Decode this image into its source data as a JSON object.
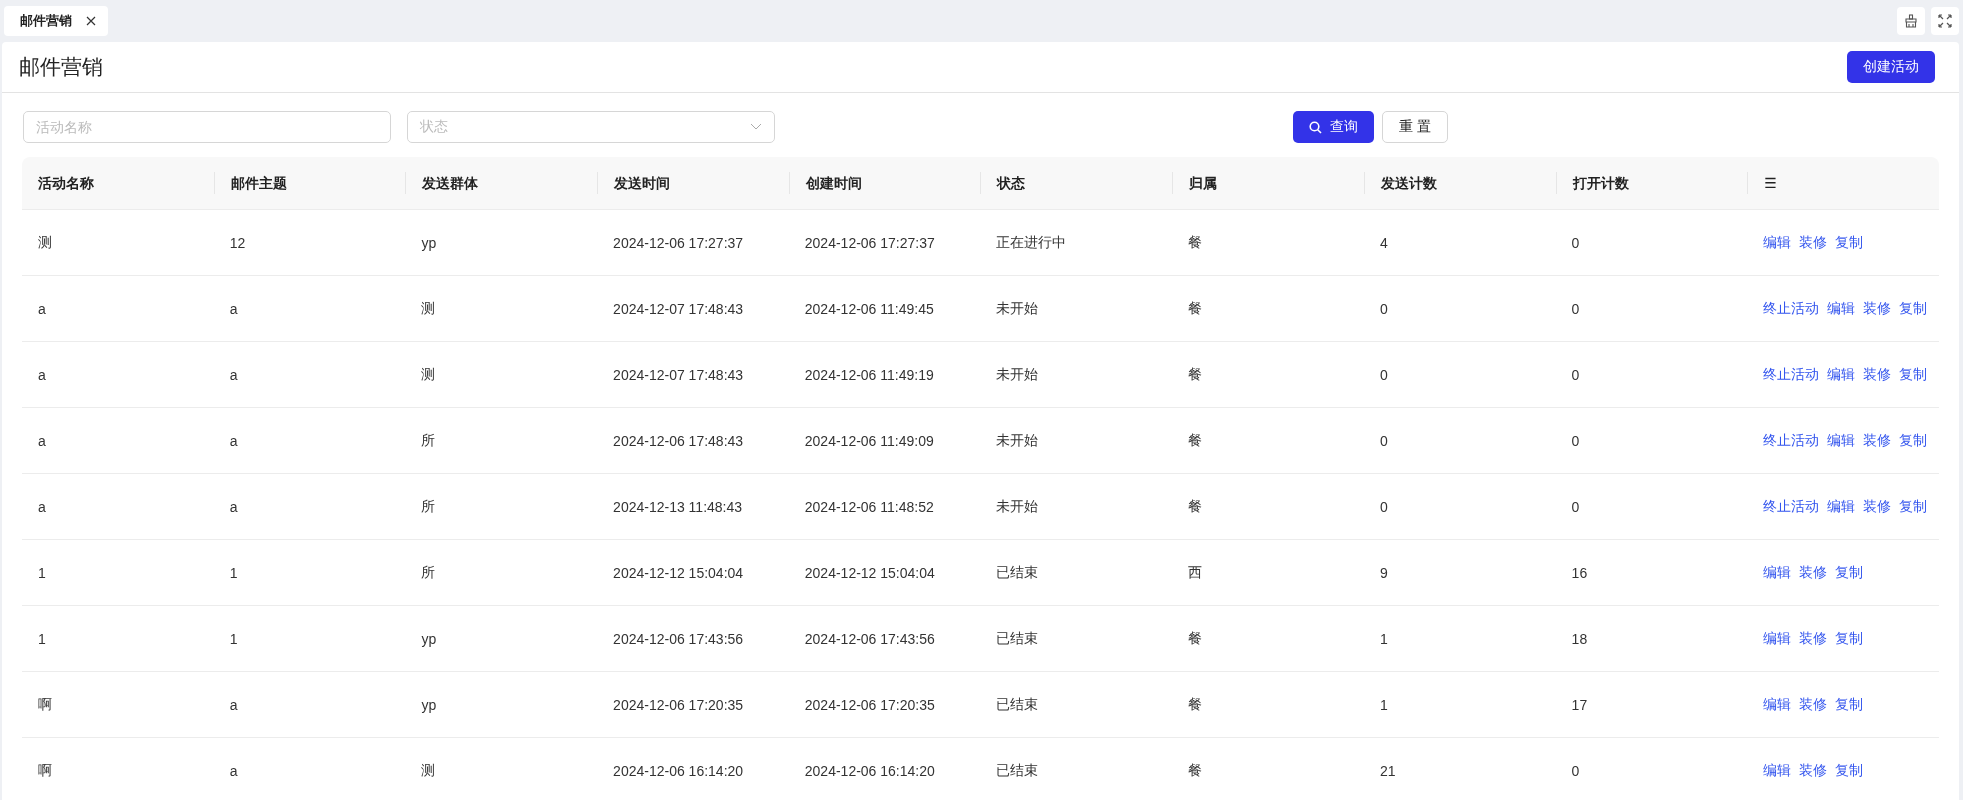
{
  "tabs": [
    {
      "label": "邮件营销",
      "selected": true
    }
  ],
  "page": {
    "title": "邮件营销",
    "create_button": "创建活动"
  },
  "filters": {
    "name": {
      "placeholder": "活动名称"
    },
    "status": {
      "placeholder": "状态"
    },
    "search_button": "查询",
    "reset_button": "重 置"
  },
  "table": {
    "columns": [
      "活动名称",
      "邮件主题",
      "发送群体",
      "发送时间",
      "创建时间",
      "状态",
      "归属",
      "发送计数",
      "打开计数",
      "☰"
    ],
    "rows": [
      {
        "cells": [
          "测",
          "12",
          "yp",
          "2024-12-06 17:27:37",
          "2024-12-06 17:27:37",
          "正在进行中",
          "餐",
          "4",
          "0"
        ],
        "actions": [
          "编辑",
          "装修",
          "复制"
        ]
      },
      {
        "cells": [
          "a",
          "a",
          "测",
          "2024-12-07 17:48:43",
          "2024-12-06 11:49:45",
          "未开始",
          "餐",
          "0",
          "0"
        ],
        "actions": [
          "终止活动",
          "编辑",
          "装修",
          "复制"
        ]
      },
      {
        "cells": [
          "a",
          "a",
          "测",
          "2024-12-07 17:48:43",
          "2024-12-06 11:49:19",
          "未开始",
          "餐",
          "0",
          "0"
        ],
        "actions": [
          "终止活动",
          "编辑",
          "装修",
          "复制"
        ]
      },
      {
        "cells": [
          "a",
          "a",
          "所",
          "2024-12-06 17:48:43",
          "2024-12-06 11:49:09",
          "未开始",
          "餐",
          "0",
          "0"
        ],
        "actions": [
          "终止活动",
          "编辑",
          "装修",
          "复制"
        ]
      },
      {
        "cells": [
          "a",
          "a",
          "所",
          "2024-12-13 11:48:43",
          "2024-12-06 11:48:52",
          "未开始",
          "餐",
          "0",
          "0"
        ],
        "actions": [
          "终止活动",
          "编辑",
          "装修",
          "复制"
        ]
      },
      {
        "cells": [
          "1",
          "1",
          "所",
          "2024-12-12 15:04:04",
          "2024-12-12 15:04:04",
          "已结束",
          "西",
          "9",
          "16"
        ],
        "actions": [
          "编辑",
          "装修",
          "复制"
        ]
      },
      {
        "cells": [
          "1",
          "1",
          "yp",
          "2024-12-06 17:43:56",
          "2024-12-06 17:43:56",
          "已结束",
          "餐",
          "1",
          "18"
        ],
        "actions": [
          "编辑",
          "装修",
          "复制"
        ]
      },
      {
        "cells": [
          "啊",
          "a",
          "yp",
          "2024-12-06 17:20:35",
          "2024-12-06 17:20:35",
          "已结束",
          "餐",
          "1",
          "17"
        ],
        "actions": [
          "编辑",
          "装修",
          "复制"
        ]
      },
      {
        "cells": [
          "啊",
          "a",
          "测",
          "2024-12-06 16:14:20",
          "2024-12-06 16:14:20",
          "已结束",
          "餐",
          "21",
          "0"
        ],
        "actions": [
          "编辑",
          "装修",
          "复制"
        ]
      }
    ]
  }
}
